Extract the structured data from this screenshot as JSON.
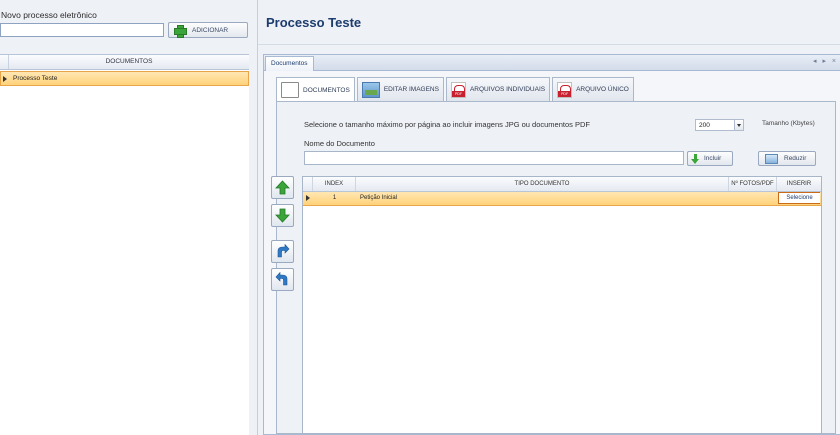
{
  "left": {
    "new_process_label": "Novo processo eletrônico",
    "new_process_value": "",
    "add_button": "ADICIONAR",
    "grid_header": "DOCUMENTOS",
    "rows": [
      {
        "name": "Processo Teste",
        "selected": true
      }
    ]
  },
  "main": {
    "title": "Processo Teste",
    "dock_tab": "Documentos",
    "dock_controls": "◂ ▸ ×",
    "tabs": [
      {
        "label": "DOCUMENTOS",
        "icon": "document-icon",
        "active": true
      },
      {
        "label": "EDITAR IMAGENS",
        "icon": "image-icon",
        "active": false
      },
      {
        "label": "ARQUIVOS INDIVIDUAIS",
        "icon": "pdf-icon",
        "active": false
      },
      {
        "label": "ARQUIVO ÚNICO",
        "icon": "pdf-icon",
        "active": false
      }
    ],
    "size_prompt": "Selecione o tamanho máximo por página ao incluir imagens JPG  ou documentos PDF",
    "size_value": "200",
    "size_unit_label": "Tamanho (Kbytes)",
    "doc_name_label": "Nome do Documento",
    "doc_name_value": "",
    "include_button": "Incluir",
    "reduce_button": "Reduzir",
    "grid": {
      "columns": [
        "INDEX",
        "TIPO DOCUMENTO",
        "Nº FOTOS/PDF",
        "INSERIR"
      ],
      "rows": [
        {
          "index": "1",
          "tipo": "Petição Inicial",
          "fotos": "",
          "inserir": "Selecione"
        }
      ]
    }
  }
}
